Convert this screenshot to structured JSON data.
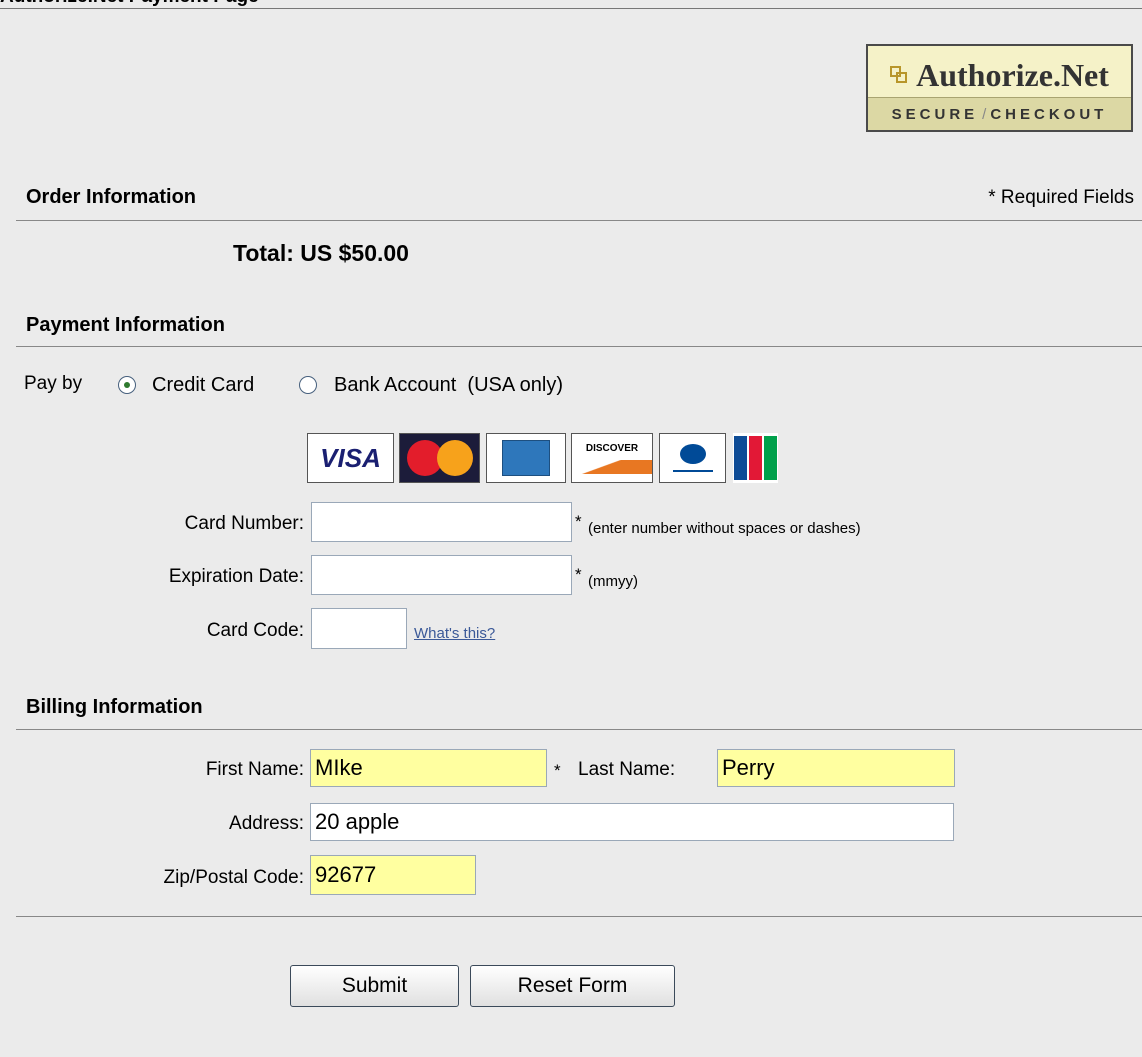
{
  "header": {
    "title": "Authorize.Net Payment Page"
  },
  "logo": {
    "brand": "Authorize.Net",
    "tagline_left": "SECURE",
    "tagline_right": "CHECKOUT"
  },
  "order": {
    "title": "Order Information",
    "required_note": "* Required Fields",
    "total": "Total: US $50.00"
  },
  "payment": {
    "title": "Payment Information",
    "pay_by_label": "Pay by",
    "options": [
      {
        "label": "Credit Card",
        "selected": true
      },
      {
        "label": "Bank Account  (USA only)",
        "selected": false
      }
    ],
    "cards": [
      {
        "name": "VISA",
        "icon": "visa-card-logo"
      },
      {
        "name": "MasterCard",
        "icon": "mastercard-logo"
      },
      {
        "name": "American Express",
        "icon": "amex-card-logo"
      },
      {
        "name": "DISCOVER",
        "icon": "discover-card-logo"
      },
      {
        "name": "Diners Club International",
        "icon": "diners-club-logo"
      },
      {
        "name": "JCB",
        "icon": "jcb-card-logo"
      }
    ],
    "card_number": {
      "label": "Card Number:",
      "value": "",
      "asterisk": "*",
      "hint": "(enter number without spaces or dashes)"
    },
    "expiration": {
      "label": "Expiration Date:",
      "value": "",
      "asterisk": "*",
      "hint": "(mmyy)"
    },
    "card_code": {
      "label": "Card Code:",
      "value": "",
      "help_link": "What's this?"
    }
  },
  "billing": {
    "title": "Billing Information",
    "first_name": {
      "label": "First Name:",
      "value": "MIke",
      "asterisk": "*"
    },
    "last_name": {
      "label": "Last Name:",
      "value": "Perry"
    },
    "address": {
      "label": "Address:",
      "value": "20 apple"
    },
    "zip": {
      "label": "Zip/Postal Code:",
      "value": "92677"
    }
  },
  "actions": {
    "submit": "Submit",
    "reset": "Reset Form"
  },
  "colors": {
    "background": "#ebebeb",
    "highlight_field": "#ffffa0",
    "link": "#3b5998",
    "logo_bg": "#f5f2c8"
  }
}
